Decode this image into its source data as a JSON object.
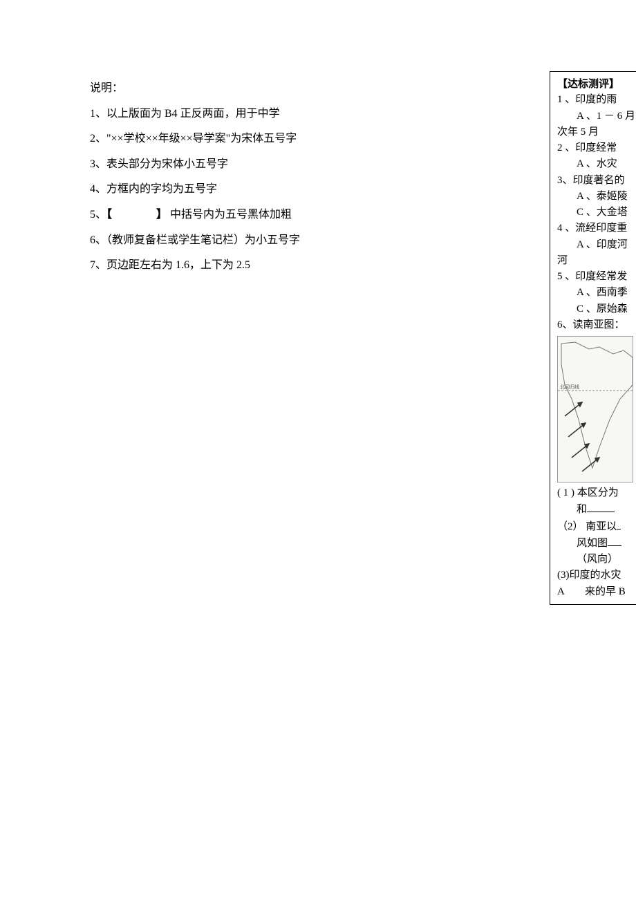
{
  "left": {
    "heading": "说明：",
    "items": [
      "1、以上版面为 B4 正反两面，用于中学",
      "2、\"××学校××年级××导学案\"为宋体五号字",
      "3、表头部分为宋体小五号字",
      "4、方框内的字均为五号字",
      "5、【　　　　】 中括号内为五号黑体加粗",
      "6、（教师复备栏或学生笔记栏）为小五号字",
      "7、页边距左右为 1.6，上下为 2.5"
    ]
  },
  "right": {
    "header": "【达标测评】",
    "q1": "1 、印度的雨",
    "q1a": "A 、1 － 6 月",
    "q1cont": "次年 5 月",
    "q2": "2 、印度经常",
    "q2a": "A 、水灾",
    "q3": "3、印度著名的",
    "q3a": "A 、泰姬陵",
    "q3c": "C 、大金塔",
    "q4": "4 、流经印度重",
    "q4a": "A 、印度河",
    "q4cont": "河",
    "q5": "5 、印度经常发",
    "q5a": "A 、西南季",
    "q5c": "C 、原始森",
    "q6": "6、读南亚图：",
    "map_label": "北回归线",
    "q61": "( 1 ) 本区分为",
    "q61b": "和",
    "q62": "（2） 南亚以",
    "q62b": "风如图",
    "q62c": "（风向）",
    "q63": "(3)印度的水灾",
    "q63a": "A　　来的早 B"
  }
}
